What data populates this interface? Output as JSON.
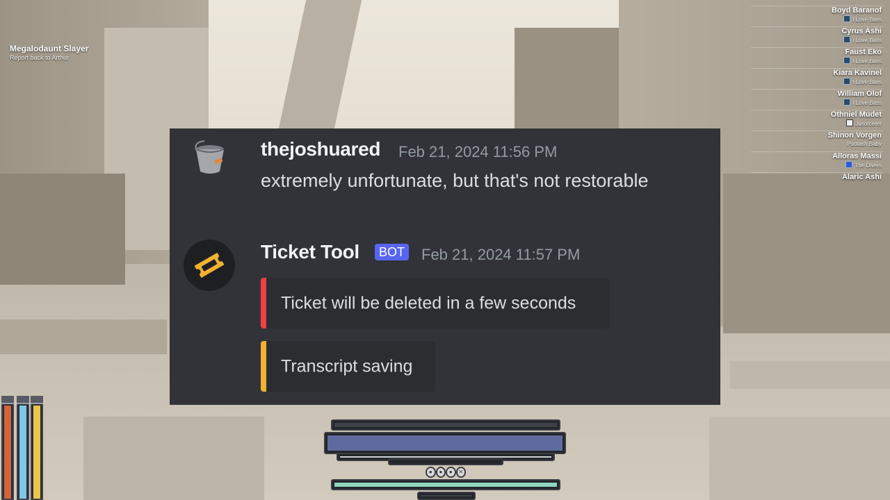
{
  "quest": {
    "title": "Megalodaunt Slayer",
    "subtitle": "Report back to Arthur"
  },
  "players": [
    {
      "name": "Boyd Baranof",
      "tag": "I Love Bass"
    },
    {
      "name": "Cyrus Ashi",
      "tag": "I Love Bass"
    },
    {
      "name": "Faust Eko",
      "tag": "I Love Bass"
    },
    {
      "name": "Kiara Kavinel",
      "tag": "I Love Bass"
    },
    {
      "name": "William Olof",
      "tag": "I Love Bass"
    },
    {
      "name": "Othniel Mudet",
      "tag": "Jusorcerer"
    },
    {
      "name": "Shinon Vorgen",
      "tag": "Pootash Baby"
    },
    {
      "name": "Alloras Massi",
      "tag": "The Divers"
    },
    {
      "name": "Alaric Ashi",
      "tag": ""
    }
  ],
  "chat": {
    "message1": {
      "author": "thejoshuared",
      "timestamp": "Feb 21, 2024 11:56 PM",
      "text": "extremely unfortunate, but that's not restorable"
    },
    "message2": {
      "author": "Ticket Tool",
      "badge": "BOT",
      "timestamp": "Feb 21, 2024 11:57 PM",
      "embeds": [
        {
          "text": "Ticket will be deleted in a few seconds",
          "accent": "#f23f43"
        },
        {
          "text": "Transcript saving",
          "accent": "#f0b232"
        }
      ]
    }
  },
  "colors": {
    "chat_bg": "#313338",
    "bot_badge": "#5865f2",
    "embed_red": "#f23f43",
    "embed_yellow": "#f0b232",
    "ticket_icon": "#f0b232"
  },
  "icons": {
    "avatar1": "bucket-icon",
    "avatar2": "ticket-icon"
  }
}
